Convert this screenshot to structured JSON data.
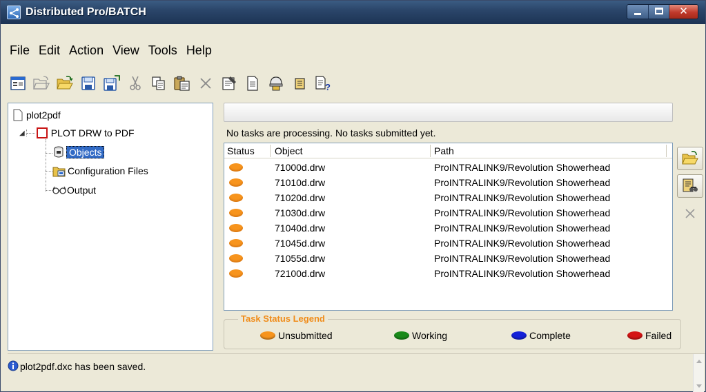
{
  "window": {
    "title": "Distributed Pro/BATCH"
  },
  "menu": [
    "File",
    "Edit",
    "Action",
    "View",
    "Tools",
    "Help"
  ],
  "toolbar_icons": [
    "properties-icon",
    "open-folder-icon",
    "open-icon",
    "save-icon",
    "save-as-icon",
    "cut-icon",
    "copy-icon",
    "paste-icon",
    "delete-icon",
    "options-icon",
    "document-icon",
    "hardhat-icon",
    "list-icon",
    "help-icon"
  ],
  "tree": {
    "root": "plot2pdf",
    "task": "PLOT DRW to PDF",
    "children": [
      "Objects",
      "Configuration Files",
      "Output"
    ]
  },
  "task_message": "No tasks are processing. No tasks submitted yet.",
  "list": {
    "columns": [
      "Status",
      "Object",
      "Path"
    ],
    "rows": [
      {
        "object": "71000d.drw",
        "path": "ProINTRALINK9/Revolution Showerhead",
        "status": "Unsubmitted"
      },
      {
        "object": "71010d.drw",
        "path": "ProINTRALINK9/Revolution Showerhead",
        "status": "Unsubmitted"
      },
      {
        "object": "71020d.drw",
        "path": "ProINTRALINK9/Revolution Showerhead",
        "status": "Unsubmitted"
      },
      {
        "object": "71030d.drw",
        "path": "ProINTRALINK9/Revolution Showerhead",
        "status": "Unsubmitted"
      },
      {
        "object": "71040d.drw",
        "path": "ProINTRALINK9/Revolution Showerhead",
        "status": "Unsubmitted"
      },
      {
        "object": "71045d.drw",
        "path": "ProINTRALINK9/Revolution Showerhead",
        "status": "Unsubmitted"
      },
      {
        "object": "71055d.drw",
        "path": "ProINTRALINK9/Revolution Showerhead",
        "status": "Unsubmitted"
      },
      {
        "object": "72100d.drw",
        "path": "ProINTRALINK9/Revolution Showerhead",
        "status": "Unsubmitted"
      }
    ]
  },
  "legend": {
    "title": "Task Status Legend",
    "items": [
      {
        "label": "Unsubmitted",
        "color": "#f7941d"
      },
      {
        "label": "Working",
        "color": "#1a8a1a"
      },
      {
        "label": "Complete",
        "color": "#1420d8"
      },
      {
        "label": "Failed",
        "color": "#d41414"
      }
    ]
  },
  "message": "plot2pdf.dxc has been saved."
}
